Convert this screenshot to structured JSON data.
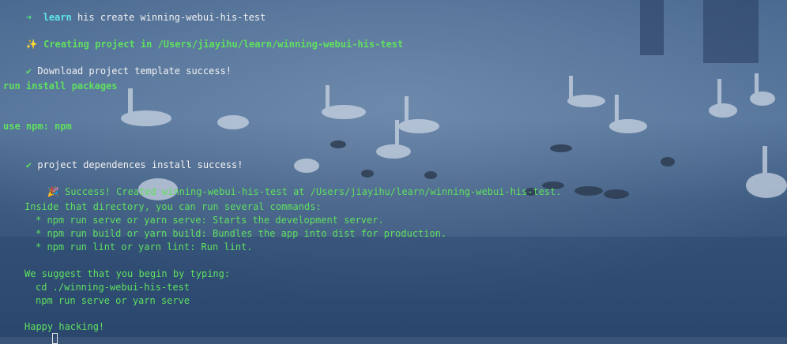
{
  "terminal": {
    "prompt_arrow": "➜",
    "prompt_dir": "learn",
    "command": "his create winning-webui-his-test",
    "creating_icon": "✨",
    "creating_text": "Creating project in /Users/jiayihu/learn/winning-webui-his-test",
    "check_icon": "✔",
    "download_text": "Download project template success!",
    "run_install": "run install packages",
    "use_npm": "use npm: npm",
    "deps_text": "project dependences install success!",
    "party_icon": "🎉",
    "success_text": "Success! Created winning-webui-his-test at /Users/jiayihu/learn/winning-webui-his-test.",
    "inside_dir": "Inside that directory, you can run several commands:",
    "cmd_serve": "* npm run serve or yarn serve: Starts the development server.",
    "cmd_build": "* npm run build or yarn build: Bundles the app into dist for production.",
    "cmd_lint": "* npm run lint or yarn lint: Run lint.",
    "suggest": "We suggest that you begin by typing:",
    "cd_cmd": "cd ./winning-webui-his-test",
    "serve_cmd": "npm run serve or yarn serve",
    "happy": "Happy hacking!"
  },
  "colors": {
    "prompt_green": "#4ee07a",
    "dir_cyan": "#5ee6e6",
    "output_green": "#5fe05f",
    "text_white": "#f2f2f2",
    "background": "#3a5478"
  },
  "background_image": "swans-on-misty-lake"
}
